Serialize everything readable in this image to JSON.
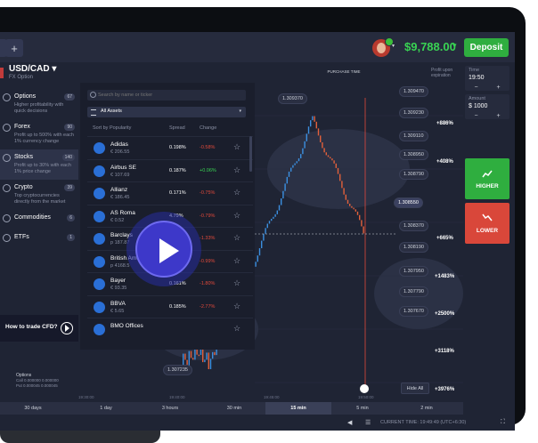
{
  "header": {
    "add_tab": "+",
    "balance": "$9,788.00",
    "deposit_label": "Deposit"
  },
  "asset": {
    "pair": "USD/CAD ▾",
    "type": "FX Option"
  },
  "leftnav": [
    {
      "title": "Options",
      "count": "67",
      "desc": "Higher profitability with quick decisions"
    },
    {
      "title": "Forex",
      "count": "90",
      "desc": "Profit up to 500% with each 1% currency change"
    },
    {
      "title": "Stocks",
      "count": "140",
      "desc": "Profit up to 30% with each 1% price change"
    },
    {
      "title": "Crypto",
      "count": "39",
      "desc": "Top cryptocurrencies directly from the market"
    },
    {
      "title": "Commodities",
      "count": "6",
      "desc": ""
    },
    {
      "title": "ETFs",
      "count": "1",
      "desc": ""
    }
  ],
  "howto": {
    "label": "How to trade CFD?"
  },
  "options_box": {
    "title": "Options",
    "line1": "Call  0.000000  0.000000",
    "line2": "Put  0.000045  0.000045"
  },
  "panel": {
    "search_placeholder": "Search by name or ticker",
    "filter": "All Assets",
    "col_sort": "Sort by Popularity",
    "col_spread": "Spread",
    "col_change": "Change",
    "rows": [
      {
        "name": "Adidas",
        "price": "€ 206.55",
        "spread": "0.198%",
        "change": "-0.58%",
        "color": "#e24a3b"
      },
      {
        "name": "Airbus SE",
        "price": "€ 107.69",
        "spread": "0.187%",
        "change": "+0.06%",
        "color": "#39d353"
      },
      {
        "name": "Allianz",
        "price": "€ 186.45",
        "spread": "0.171%",
        "change": "-0.75%",
        "color": "#e24a3b"
      },
      {
        "name": "AS Roma",
        "price": "€ 0.52",
        "spread": "4.79%",
        "change": "-0.79%",
        "color": "#e24a3b"
      },
      {
        "name": "Barclays",
        "price": "p 187.87",
        "spread": "0.182%",
        "change": "-1.33%",
        "color": "#e24a3b"
      },
      {
        "name": "British American T...",
        "price": "p 4168.5",
        "spread": "0.174%",
        "change": "-0.99%",
        "color": "#e24a3b"
      },
      {
        "name": "Bayer",
        "price": "€ 93.35",
        "spread": "0.161%",
        "change": "-1.80%",
        "color": "#e24a3b"
      },
      {
        "name": "BBVA",
        "price": "€ 5.65",
        "spread": "0.185%",
        "change": "-2.77%",
        "color": "#e24a3b"
      },
      {
        "name": "BMO Offices",
        "price": "",
        "spread": "",
        "change": "",
        "color": "#e24a3b"
      }
    ]
  },
  "chart": {
    "current_price": "1.308550",
    "price_labels": [
      "1.309470",
      "1.309370",
      "1.309230",
      "1.309110",
      "1.308950",
      "1.308790",
      "1.308370",
      "1.308190",
      "1.307950",
      "1.307790",
      "1.307670",
      "1.307235"
    ],
    "pct_labels": [
      "+886%",
      "+408%",
      "+665%",
      "+1483%",
      "+2500%",
      "+3118%",
      "+3976%"
    ],
    "purchase_time": "PURCHASE TIME",
    "profit_expiration": "Profit upon expiration",
    "hide_all": "Hide All",
    "time_labels": [
      "19:30:00",
      "19:40:00",
      "19:45:00",
      "19:50:00"
    ]
  },
  "trade": {
    "time_label": "Time",
    "time_value": "19:50",
    "amount_label": "Amount",
    "amount_value": "$ 1000",
    "higher": "HIGHER",
    "lower": "LOWER",
    "minus": "−",
    "plus": "+"
  },
  "timeframes": [
    "30 days",
    "1 day",
    "3 hours",
    "30 min",
    "15 min",
    "5 min",
    "2 min"
  ],
  "active_timeframe": "15 min",
  "status": {
    "current_time": "CURRENT TIME: 19:49:49 (UTC+6:30)"
  }
}
